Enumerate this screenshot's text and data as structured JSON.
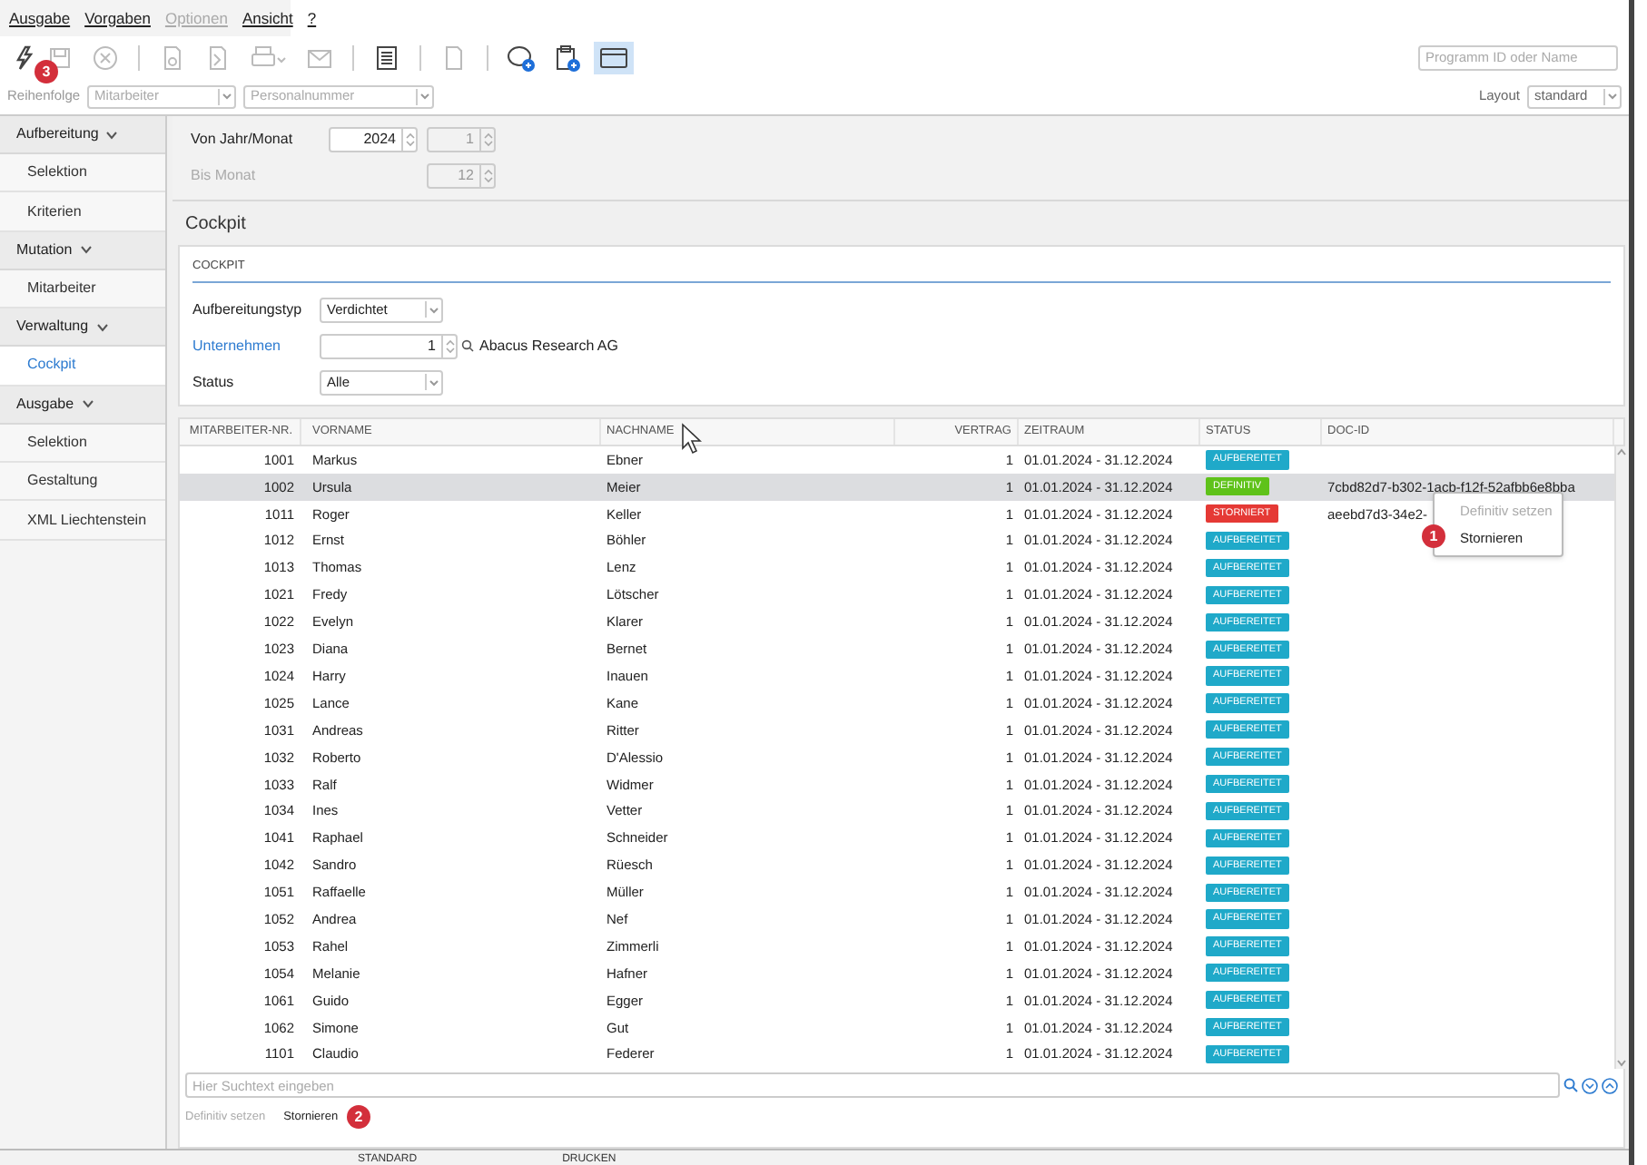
{
  "menu": [
    {
      "label": "Ausgabe",
      "disabled": false
    },
    {
      "label": "Vorgaben",
      "disabled": false
    },
    {
      "label": "Optionen",
      "disabled": true
    },
    {
      "label": "Ansicht",
      "disabled": false
    },
    {
      "label": "?",
      "disabled": false
    }
  ],
  "toolbar": [
    {
      "kind": "bolt",
      "disabled": false,
      "selected": false
    },
    {
      "kind": "save",
      "disabled": true,
      "selected": false
    },
    {
      "kind": "cancel",
      "disabled": true,
      "selected": false
    },
    {
      "kind": "sep"
    },
    {
      "kind": "preview",
      "disabled": true,
      "selected": false
    },
    {
      "kind": "pdf",
      "disabled": true,
      "selected": false
    },
    {
      "kind": "print",
      "disabled": true,
      "selected": false
    },
    {
      "kind": "mail",
      "disabled": true,
      "selected": false
    },
    {
      "kind": "sep"
    },
    {
      "kind": "notes",
      "disabled": false,
      "selected": false
    },
    {
      "kind": "sep"
    },
    {
      "kind": "doc",
      "disabled": true,
      "selected": false
    },
    {
      "kind": "sep"
    },
    {
      "kind": "chat",
      "disabled": false,
      "selected": false
    },
    {
      "kind": "clipboard",
      "disabled": false,
      "selected": false
    },
    {
      "kind": "window",
      "disabled": false,
      "selected": true
    }
  ],
  "program_search": {
    "placeholder": "Programm ID oder Name"
  },
  "order": {
    "label": "Reihenfolge",
    "field_1": "Mitarbeiter",
    "field_2": "Personalnummer"
  },
  "layout": {
    "label": "Layout",
    "value": "standard"
  },
  "markers": [
    {
      "text": "1"
    },
    {
      "text": "2"
    },
    {
      "text": "3"
    }
  ],
  "sidebar": [
    {
      "label": "Aufbereitung",
      "expanded": true,
      "children": [
        {
          "label": "Selektion",
          "selected": false
        },
        {
          "label": "Kriterien",
          "selected": false
        }
      ]
    },
    {
      "label": "Mutation",
      "expanded": true,
      "children": [
        {
          "label": "Mitarbeiter",
          "selected": false
        }
      ]
    },
    {
      "label": "Verwaltung",
      "expanded": true,
      "children": [
        {
          "label": "Cockpit",
          "selected": true
        }
      ]
    },
    {
      "label": "Ausgabe",
      "expanded": true,
      "children": [
        {
          "label": "Selektion",
          "selected": false
        },
        {
          "label": "Gestaltung",
          "selected": false
        },
        {
          "label": "XML Liechtenstein",
          "selected": false
        }
      ]
    }
  ],
  "period": {
    "from_label": "Von Jahr/Monat",
    "from_year": "2024",
    "from_month": "1",
    "to_label": "Bis Monat",
    "to_month": "12"
  },
  "section_title": "Cockpit",
  "cockpit": {
    "title": "COCKPIT",
    "type_label": "Aufbereitungstyp",
    "type_value": "Verdichtet",
    "company_label": "Unternehmen",
    "company_value": "1",
    "company_name": "Abacus Research AG",
    "status_label": "Status",
    "status_value": "Alle"
  },
  "table": {
    "columns": [
      "MITARBEITER-NR.",
      "VORNAME",
      "NACHNAME",
      "VERTRAG",
      "ZEITRAUM",
      "STATUS",
      "DOC-ID"
    ],
    "rows": [
      {
        "nr": "1001",
        "first": "Markus",
        "last": "Ebner",
        "contract": "1",
        "period": "01.01.2024 - 31.12.2024",
        "status": "AUFBEREITET",
        "kind": "prepared",
        "selected": false
      },
      {
        "nr": "1002",
        "first": "Ursula",
        "last": "Meier",
        "contract": "1",
        "period": "01.01.2024 - 31.12.2024",
        "status": "DEFINITIV",
        "kind": "final",
        "doc_id": "7cbd82d7-b302-1acb-f12f-52afbb6e8bba",
        "selected": true
      },
      {
        "nr": "1011",
        "first": "Roger",
        "last": "Keller",
        "contract": "1",
        "period": "01.01.2024 - 31.12.2024",
        "status": "STORNIERT",
        "kind": "cancelled",
        "doc_id": "aeebd7d3-34e2-",
        "selected": false
      },
      {
        "nr": "1012",
        "first": "Ernst",
        "last": "Böhler",
        "contract": "1",
        "period": "01.01.2024 - 31.12.2024",
        "status": "AUFBEREITET",
        "kind": "prepared",
        "selected": false
      },
      {
        "nr": "1013",
        "first": "Thomas",
        "last": "Lenz",
        "contract": "1",
        "period": "01.01.2024 - 31.12.2024",
        "status": "AUFBEREITET",
        "kind": "prepared",
        "selected": false
      },
      {
        "nr": "1021",
        "first": "Fredy",
        "last": "Lötscher",
        "contract": "1",
        "period": "01.01.2024 - 31.12.2024",
        "status": "AUFBEREITET",
        "kind": "prepared",
        "selected": false
      },
      {
        "nr": "1022",
        "first": "Evelyn",
        "last": "Klarer",
        "contract": "1",
        "period": "01.01.2024 - 31.12.2024",
        "status": "AUFBEREITET",
        "kind": "prepared",
        "selected": false
      },
      {
        "nr": "1023",
        "first": "Diana",
        "last": "Bernet",
        "contract": "1",
        "period": "01.01.2024 - 31.12.2024",
        "status": "AUFBEREITET",
        "kind": "prepared",
        "selected": false
      },
      {
        "nr": "1024",
        "first": "Harry",
        "last": "Inauen",
        "contract": "1",
        "period": "01.01.2024 - 31.12.2024",
        "status": "AUFBEREITET",
        "kind": "prepared",
        "selected": false
      },
      {
        "nr": "1025",
        "first": "Lance",
        "last": "Kane",
        "contract": "1",
        "period": "01.01.2024 - 31.12.2024",
        "status": "AUFBEREITET",
        "kind": "prepared",
        "selected": false
      },
      {
        "nr": "1031",
        "first": "Andreas",
        "last": "Ritter",
        "contract": "1",
        "period": "01.01.2024 - 31.12.2024",
        "status": "AUFBEREITET",
        "kind": "prepared",
        "selected": false
      },
      {
        "nr": "1032",
        "first": "Roberto",
        "last": "D'Alessio",
        "contract": "1",
        "period": "01.01.2024 - 31.12.2024",
        "status": "AUFBEREITET",
        "kind": "prepared",
        "selected": false
      },
      {
        "nr": "1033",
        "first": "Ralf",
        "last": "Widmer",
        "contract": "1",
        "period": "01.01.2024 - 31.12.2024",
        "status": "AUFBEREITET",
        "kind": "prepared",
        "selected": false
      },
      {
        "nr": "1034",
        "first": "Ines",
        "last": "Vetter",
        "contract": "1",
        "period": "01.01.2024 - 31.12.2024",
        "status": "AUFBEREITET",
        "kind": "prepared",
        "selected": false
      },
      {
        "nr": "1041",
        "first": "Raphael",
        "last": "Schneider",
        "contract": "1",
        "period": "01.01.2024 - 31.12.2024",
        "status": "AUFBEREITET",
        "kind": "prepared",
        "selected": false
      },
      {
        "nr": "1042",
        "first": "Sandro",
        "last": "Rüesch",
        "contract": "1",
        "period": "01.01.2024 - 31.12.2024",
        "status": "AUFBEREITET",
        "kind": "prepared",
        "selected": false
      },
      {
        "nr": "1051",
        "first": "Raffaelle",
        "last": "Müller",
        "contract": "1",
        "period": "01.01.2024 - 31.12.2024",
        "status": "AUFBEREITET",
        "kind": "prepared",
        "selected": false
      },
      {
        "nr": "1052",
        "first": "Andrea",
        "last": "Nef",
        "contract": "1",
        "period": "01.01.2024 - 31.12.2024",
        "status": "AUFBEREITET",
        "kind": "prepared",
        "selected": false
      },
      {
        "nr": "1053",
        "first": "Rahel",
        "last": "Zimmerli",
        "contract": "1",
        "period": "01.01.2024 - 31.12.2024",
        "status": "AUFBEREITET",
        "kind": "prepared",
        "selected": false
      },
      {
        "nr": "1054",
        "first": "Melanie",
        "last": "Hafner",
        "contract": "1",
        "period": "01.01.2024 - 31.12.2024",
        "status": "AUFBEREITET",
        "kind": "prepared",
        "selected": false
      },
      {
        "nr": "1061",
        "first": "Guido",
        "last": "Egger",
        "contract": "1",
        "period": "01.01.2024 - 31.12.2024",
        "status": "AUFBEREITET",
        "kind": "prepared",
        "selected": false
      },
      {
        "nr": "1062",
        "first": "Simone",
        "last": "Gut",
        "contract": "1",
        "period": "01.01.2024 - 31.12.2024",
        "status": "AUFBEREITET",
        "kind": "prepared",
        "selected": false
      },
      {
        "nr": "1101",
        "first": "Claudio",
        "last": "Federer",
        "contract": "1",
        "period": "01.01.2024 - 31.12.2024",
        "status": "AUFBEREITET",
        "kind": "prepared",
        "selected": false
      }
    ]
  },
  "context_menu": [
    {
      "label": "Definitiv setzen",
      "disabled": true
    },
    {
      "label": "Stornieren",
      "disabled": false
    }
  ],
  "table_search": {
    "placeholder": "Hier Suchtext eingeben"
  },
  "actions": [
    {
      "label": "Definitiv setzen",
      "disabled": true
    },
    {
      "label": "Stornieren",
      "disabled": false
    }
  ],
  "bottom_tabs": [
    "STANDARD",
    "DRUCKEN"
  ]
}
